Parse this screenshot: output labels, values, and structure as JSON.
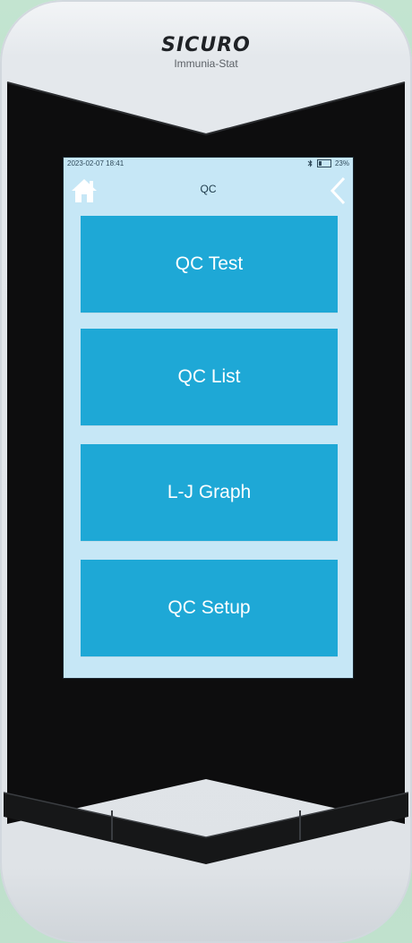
{
  "device": {
    "brand": "SICURO",
    "model": "Immunia-Stat"
  },
  "status": {
    "datetime": "2023-02-07 18:41",
    "battery": "23%",
    "battery_level_percent": 23,
    "bluetooth_icon": "bluetooth-icon"
  },
  "header": {
    "title": "QC",
    "home_icon": "home-icon",
    "back_icon": "chevron-left-icon"
  },
  "menu": {
    "items": [
      {
        "label": "QC Test"
      },
      {
        "label": "QC List"
      },
      {
        "label": "L-J Graph"
      },
      {
        "label": "QC Setup"
      }
    ]
  },
  "colors": {
    "screen_bg": "#c6e7f6",
    "button_bg": "#1ea8d6",
    "button_text": "#ffffff"
  }
}
